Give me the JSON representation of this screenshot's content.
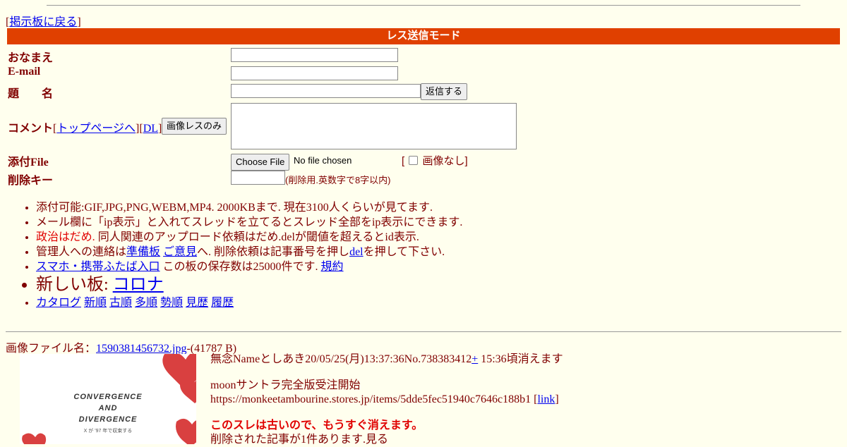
{
  "nav": {
    "back_prefix": "[",
    "back_link": "掲示板に戻る",
    "back_suffix": "]"
  },
  "mode_title": "レス送信モード",
  "form": {
    "name_label": "おなまえ",
    "email_label": "E-mail",
    "subject_label": "題　　名",
    "reply_button": "返信する",
    "comment_label": "コメント",
    "top_page_link": "トップページへ",
    "dl_link": "DL",
    "image_only_button": "画像レスのみ",
    "attach_label": "添付File",
    "choose_file_button": "Choose File",
    "file_status": "No file chosen",
    "no_image_open": "[",
    "no_image_label": "画像なし]",
    "delkey_label": "削除キー",
    "delkey_hint": "(削除用.英数字で8字以内)"
  },
  "notes": {
    "line1": "添付可能:GIF,JPG,PNG,WEBM,MP4. 2000KBまで. 現在3100人くらいが見てます.",
    "line2": "メール欄に「ip表示」と入れてスレッドを立てるとスレッド全部をip表示にできます.",
    "line3_red": "政治はだめ.",
    "line3_rest": " 同人関連のアップロード依頼はだめ.delが閾値を超えるとid表示.",
    "line4_a": "管理人への連絡は",
    "line4_link1": "準備板",
    "line4_link2": "ご意見",
    "line4_b": "へ. 削除依頼は記事番号を押し",
    "line4_link3": "del",
    "line4_c": "を押して下さい.",
    "line5_link": "スマホ・携帯ふたば入口",
    "line5_text": " この板の保存数は25000件です. ",
    "line5_link2": "規約",
    "line6_text": "新しい板: ",
    "line6_link": "コロナ",
    "sort_links": [
      "カタログ",
      "新順",
      "古順",
      "多順",
      "勢順",
      "見歴",
      "履歴"
    ]
  },
  "thread": {
    "file_label": "画像ファイル名：",
    "file_name": "1590381456732.jpg",
    "file_size": "-(41787 B)",
    "thumb_text1": "CONVERGENCE",
    "thumb_text2": "AND",
    "thumb_text3": "DIVERGENCE",
    "thumb_text4": "X が '97 年で収束する",
    "post_header": "無念Nameとしあき20/05/25(月)13:37:36No.738383412",
    "post_plus": "+",
    "post_expire": " 15:36頃消えます",
    "body_line1": "moonサントラ完全版受注開始",
    "body_line2": "https://monkeetambourine.stores.jp/items/5dde5fec51940c7646c188b1 [",
    "body_link": "link",
    "body_line2_end": "]",
    "old_warning": "このスレは古いので、もうすぐ消えます。",
    "deleted_note": "削除された記事が1件あります.見る"
  },
  "colors": {
    "bar": "#e04000",
    "bg": "#ffffee",
    "text": "#800000",
    "link": "#0000ee",
    "warn": "#e00000"
  }
}
